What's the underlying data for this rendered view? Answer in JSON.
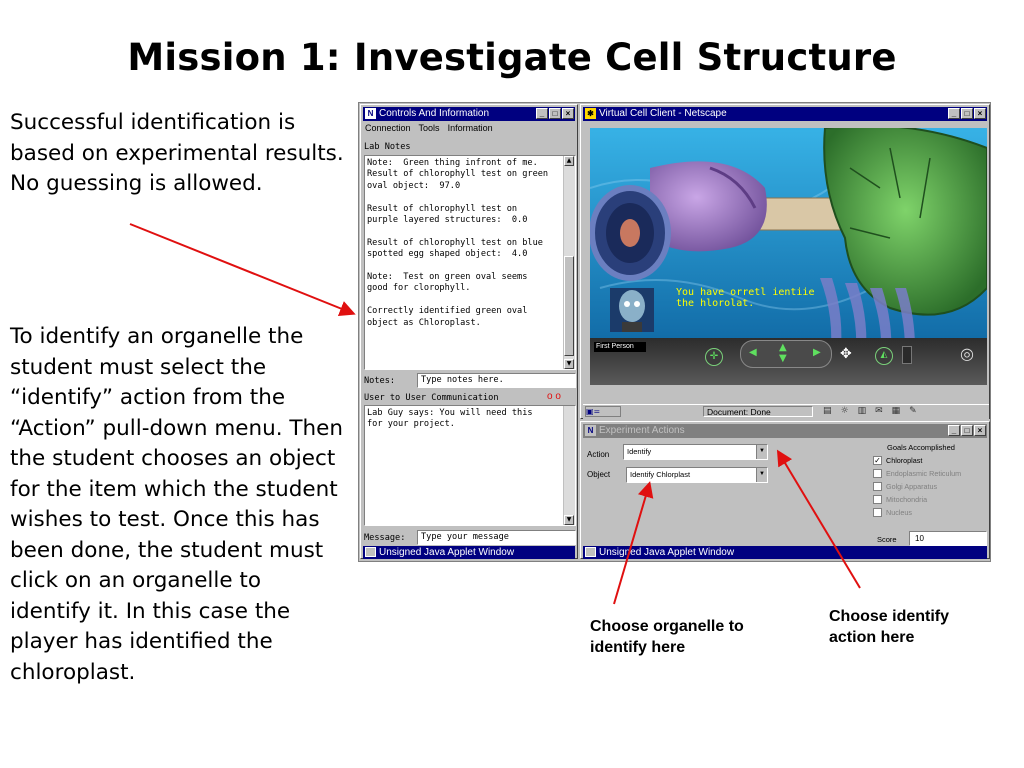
{
  "slide": {
    "title": "Mission 1: Investigate Cell Structure",
    "para1": "Successful identification is based on experimental results. No guessing is allowed.",
    "para2": "To identify an organelle the student must select the “identify” action from the “Action” pull-down menu. Then the student chooses an object for the item which the student wishes to test. Once this has been done, the student must click on an organelle to identify it. In this case the player has identified the chloroplast.",
    "caption_object": "Choose organelle to identify here",
    "caption_action": "Choose identify action here"
  },
  "controls_window": {
    "title": "Controls And Information",
    "menu": [
      "Connection",
      "Tools",
      "Information"
    ],
    "lab_notes_label": "Lab Notes",
    "lab_notes_lines": [
      "Note:  Green thing infront of me.",
      "Result of chlorophyll test on green",
      "oval object:  97.0",
      "",
      "Result of chlorophyll test on",
      "purple layered structures:  0.0",
      "",
      "Result of chlorophyll test on blue",
      "spotted egg shaped object:  4.0",
      "",
      "Note:  Test on green oval seems",
      "good for clorophyll.",
      "",
      "Correctly identified green oval",
      "object as Chloroplast."
    ],
    "notes_label": "Notes:",
    "notes_placeholder": "Type notes here.",
    "comm_label": "User to User Communication",
    "comm_indicator": "o o",
    "comm_lines": [
      "Lab Guy says: You will need this",
      "for your project."
    ],
    "message_label": "Message:",
    "message_placeholder": "Type your message",
    "status": "Unsigned Java Applet Window"
  },
  "netscape_window": {
    "title": "Virtual Cell Client - Netscape",
    "scene_text_line1": "You have orretl ientiie",
    "scene_text_line2": "the hlorolat.",
    "nav_mode": "First Person",
    "document_status": "Document: Done"
  },
  "experiment_window": {
    "title": "Experiment Actions",
    "action_label": "Action",
    "action_value": "Identify",
    "object_label": "Object",
    "object_value": "Identify Chlorplast",
    "goals_title": "Goals Accomplished",
    "goals": [
      {
        "label": "Chloroplast",
        "checked": true
      },
      {
        "label": "Endoplasmic Reticulum",
        "checked": false
      },
      {
        "label": "Golgi Apparatus",
        "checked": false
      },
      {
        "label": "Mitochondria",
        "checked": false
      },
      {
        "label": "Nucleus",
        "checked": false
      }
    ],
    "score_label": "Score",
    "score_value": "10",
    "status": "Unsigned Java Applet Window"
  },
  "colors": {
    "titlebar_active": "#000080",
    "window_face": "#c0c0c0",
    "arrow": "#e01010"
  }
}
